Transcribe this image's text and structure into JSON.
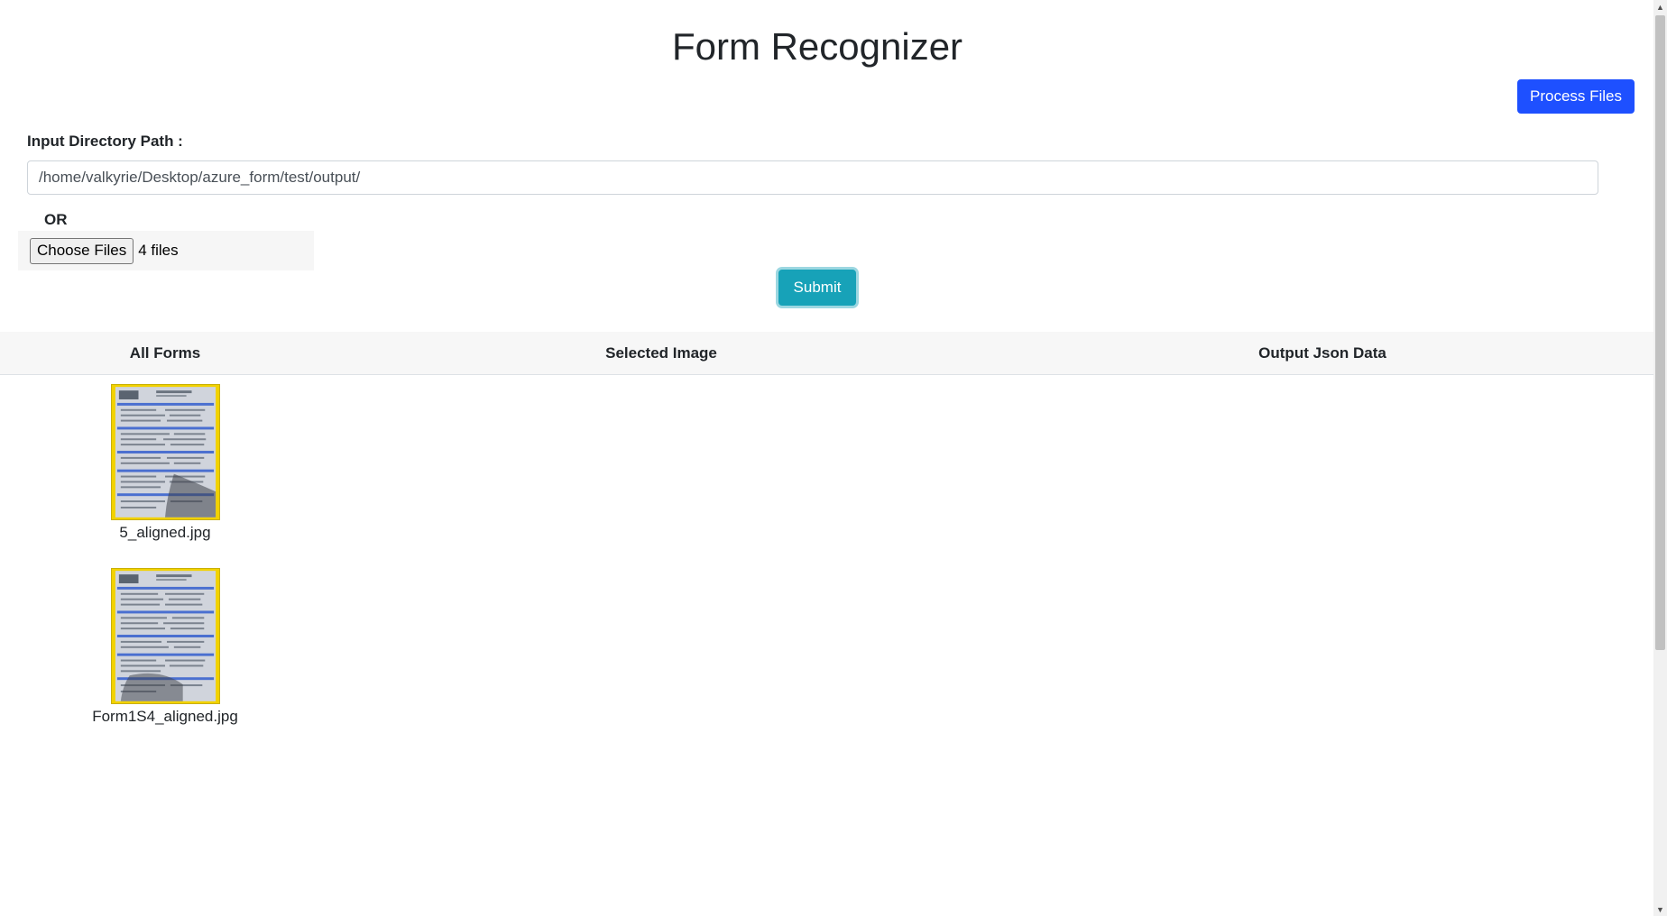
{
  "header": {
    "title": "Form Recognizer",
    "process_button": "Process Files"
  },
  "input": {
    "label": "Input Directory Path :",
    "value": "/home/valkyrie/Desktop/azure_form/test/output/",
    "or_label": "OR",
    "choose_files_button": "Choose Files",
    "files_selected": "4 files"
  },
  "submit_button": "Submit",
  "table": {
    "columns": [
      "All Forms",
      "Selected Image",
      "Output Json Data"
    ]
  },
  "forms": [
    {
      "name": "5_aligned.jpg",
      "thumb_icon": "form-document-thumbnail"
    },
    {
      "name": "Form1S4_aligned.jpg",
      "thumb_icon": "form-document-thumbnail"
    }
  ],
  "colors": {
    "primary": "#1e50ff",
    "info": "#17a2b8",
    "header_bg": "#f7f7f7",
    "thumb_border": "#f2d200"
  }
}
